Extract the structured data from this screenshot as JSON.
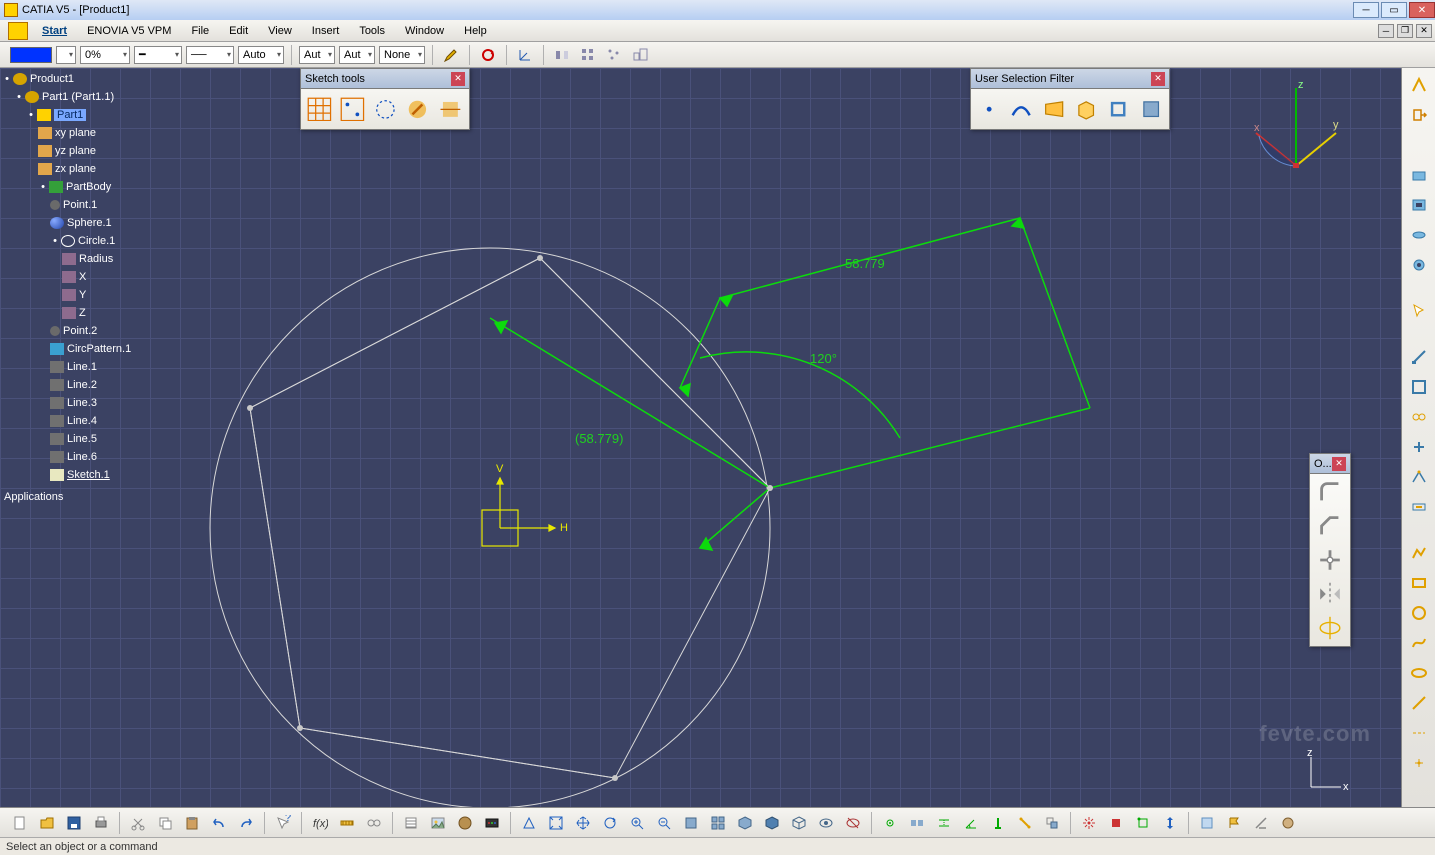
{
  "app": {
    "title": "CATIA V5 - [Product1]"
  },
  "menu": {
    "start": "Start",
    "items": [
      "ENOVIA V5 VPM",
      "File",
      "Edit",
      "View",
      "Insert",
      "Tools",
      "Window",
      "Help"
    ]
  },
  "prop": {
    "pct": "0%",
    "auto1": "Auto",
    "auto2": "Aut",
    "auto3": "Aut",
    "none": "None"
  },
  "sketchTools": {
    "title": "Sketch tools"
  },
  "userFilter": {
    "title": "User Selection Filter"
  },
  "opsToolbar": {
    "title": "O..."
  },
  "dims": {
    "d1": "58.779",
    "d2": "(58.779)",
    "ang": "120°"
  },
  "axes": {
    "h": "H",
    "v": "V",
    "x": "x",
    "y": "y",
    "z": "z"
  },
  "tree": {
    "root": "Product1",
    "part11": "Part1 (Part1.1)",
    "part1": "Part1",
    "xy": "xy plane",
    "yz": "yz plane",
    "zx": "zx plane",
    "body": "PartBody",
    "pt1": "Point.1",
    "sph": "Sphere.1",
    "circ": "Circle.1",
    "rad": "Radius",
    "X": "X",
    "Y": "Y",
    "Z": "Z",
    "pt2": "Point.2",
    "patt": "CircPattern.1",
    "l1": "Line.1",
    "l2": "Line.2",
    "l3": "Line.3",
    "l4": "Line.4",
    "l5": "Line.5",
    "l6": "Line.6",
    "sk": "Sketch.1",
    "apps": "Applications"
  },
  "status": {
    "msg": "Select an object or a command"
  },
  "watermark": "fevte.com"
}
